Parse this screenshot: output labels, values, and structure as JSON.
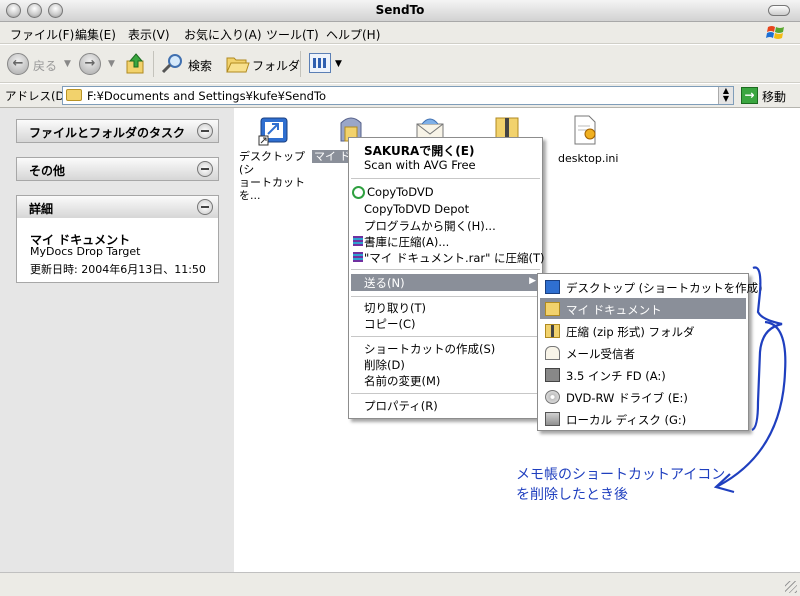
{
  "window": {
    "title": "SendTo"
  },
  "menubar": {
    "items": [
      "ファイル(F)",
      "編集(E)",
      "表示(V)",
      "お気に入り(A)",
      "ツール(T)",
      "ヘルプ(H)"
    ]
  },
  "toolbar": {
    "back": "戻る",
    "search": "検索",
    "folders": "フォルダ"
  },
  "address": {
    "label": "アドレス(D)",
    "path": "F:¥Documents and Settings¥kufe¥SendTo",
    "go": "移動"
  },
  "tasks": {
    "file_folder_tasks": "ファイルとフォルダのタスク",
    "other": "その他",
    "details": "詳細",
    "detail_name": "マイ ドキュメント",
    "detail_type": "MyDocs Drop Target",
    "detail_date": "更新日時: 2004年6月13日、11:50"
  },
  "files": {
    "desktop_shortcut_l1": "デスクトップ (シ",
    "desktop_shortcut_l2": "ョートカットを...",
    "mydocs": "マイ ド",
    "desktop_ini": "desktop.ini"
  },
  "context_menu": {
    "sakura_open": "SAKURAで開く(E)",
    "avg_scan": "Scan with AVG Free",
    "copytodvd": "CopyToDVD",
    "copytodvd_depot": "CopyToDVD Depot",
    "open_with": "プログラムから開く(H)...",
    "compress_to_library": "書庫に圧縮(A)...",
    "compress_rar": "\"マイ ドキュメント.rar\" に圧縮(T)",
    "send_to": "送る(N)",
    "cut": "切り取り(T)",
    "copy": "コピー(C)",
    "create_shortcut": "ショートカットの作成(S)",
    "delete": "削除(D)",
    "rename": "名前の変更(M)",
    "properties": "プロパティ(R)"
  },
  "send_to_menu": {
    "items": [
      "デスクトップ (ショートカットを作成)",
      "マイ ドキュメント",
      "圧縮 (zip 形式) フォルダ",
      "メール受信者",
      "3.5 インチ FD (A:)",
      "DVD-RW ドライブ (E:)",
      "ローカル ディスク (G:)"
    ]
  },
  "annotation": {
    "line1": "メモ帳のショートカットアイコン",
    "line2": "を削除したとき後"
  },
  "colors": {
    "annotation": "#1f3fbf",
    "menu_highlight": "#8a8f99"
  }
}
